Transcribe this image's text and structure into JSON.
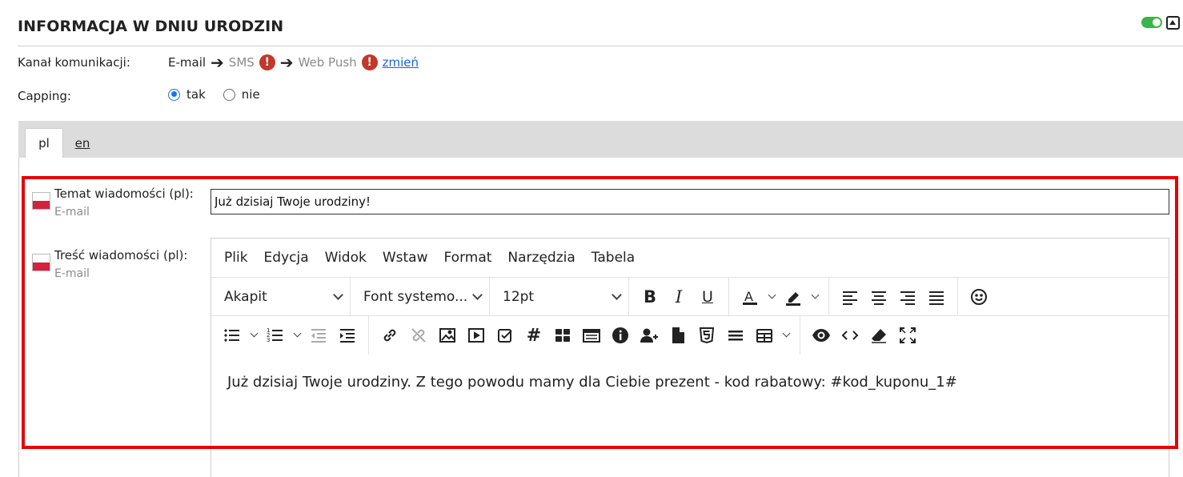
{
  "header": {
    "title": "INFORMACJA W DNIU URODZIN"
  },
  "channel": {
    "label": "Kanał komunikacji:",
    "email": "E-mail",
    "sms": "SMS",
    "webpush": "Web Push",
    "change_link": "zmień"
  },
  "capping": {
    "label": "Capping:",
    "options": [
      {
        "label": "tak",
        "checked": true
      },
      {
        "label": "nie",
        "checked": false
      }
    ]
  },
  "tabs": [
    {
      "label": "pl",
      "active": true
    },
    {
      "label": "en",
      "active": false
    }
  ],
  "subject": {
    "label": "Temat wiadomości (pl):",
    "sub": "E-mail",
    "value": "Już dzisiaj Twoje urodziny!"
  },
  "body": {
    "label": "Treść wiadomości (pl):",
    "sub": "E-mail",
    "menu": [
      "Plik",
      "Edycja",
      "Widok",
      "Wstaw",
      "Format",
      "Narzędzia",
      "Tabela"
    ],
    "block_format": "Akapit",
    "font_family": "Font systemo...",
    "font_size": "12pt",
    "content": "Już dzisiaj Twoje urodziny. Z tego powodu mamy dla Ciebie prezent - kod rabatowy: #kod_kuponu_1#"
  },
  "colors": {
    "toggle_on": "#3ab54a",
    "warning": "#c0392b",
    "link": "#1a66d6",
    "highlight_border": "#e80000"
  }
}
